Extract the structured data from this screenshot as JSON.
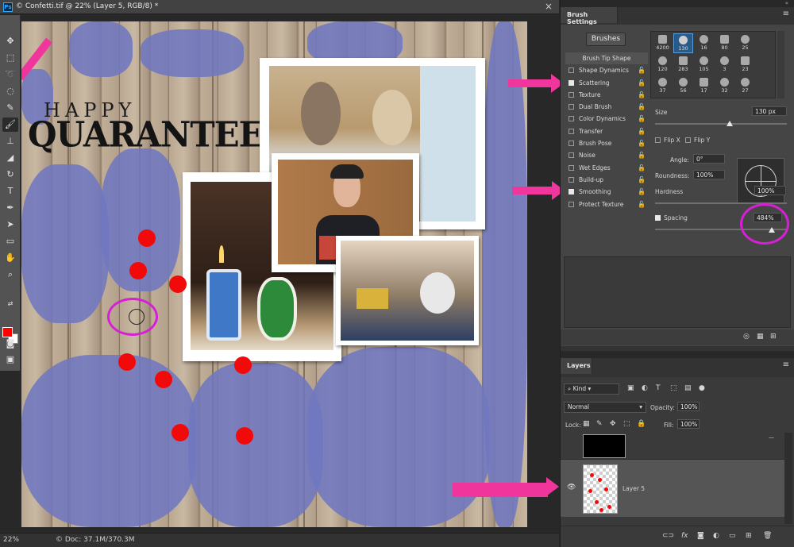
{
  "document": {
    "title": "Confetti.tif @ 22% (Layer 5, RGB/8) *",
    "close_glyph": "×",
    "logo": "Ps"
  },
  "toolbar": {
    "tools": [
      "move-tool",
      "marquee-tool",
      "lasso-tool",
      "quick-select-tool",
      "crop-tool",
      "eyedropper-tool",
      "healing-tool",
      "brush-tool",
      "stamp-tool",
      "history-brush-tool",
      "eraser-tool",
      "gradient-tool",
      "text-tool",
      "pen-tool",
      "path-select-tool",
      "shape-tool",
      "hand-tool",
      "zoom-tool"
    ],
    "active": "brush-tool",
    "fg_color": "#ff0000",
    "bg_color": "#ffffff"
  },
  "canvas": {
    "happy_text": "HAPPY",
    "quaranteen_text": "QUARANTEEN",
    "dot_color": "#f20a0a",
    "annotation_color": "#f0359d",
    "ring_color": "#d61fd6"
  },
  "status": {
    "zoom": "22%",
    "doc_size": "Doc: 37.1M/370.3M"
  },
  "brush_settings": {
    "tab": "Brush Settings",
    "brushes_button": "Brushes",
    "options": [
      {
        "label": "Brush Tip Shape",
        "header": true
      },
      {
        "label": "Shape Dynamics",
        "checked": false
      },
      {
        "label": "Scattering",
        "checked": true
      },
      {
        "label": "Texture",
        "checked": false
      },
      {
        "label": "Dual Brush",
        "checked": false
      },
      {
        "label": "Color Dynamics",
        "checked": false
      },
      {
        "label": "Transfer",
        "checked": false
      },
      {
        "label": "Brush Pose",
        "checked": false
      },
      {
        "label": "Noise",
        "checked": false
      },
      {
        "label": "Wet Edges",
        "checked": false
      },
      {
        "label": "Build-up",
        "checked": false
      },
      {
        "label": "Smoothing",
        "checked": true
      },
      {
        "label": "Protect Texture",
        "checked": false
      }
    ],
    "tips": [
      "4200",
      "130",
      "16",
      "80",
      "25",
      "120",
      "283",
      "105",
      "3",
      "23",
      "37",
      "56",
      "17",
      "32",
      "27"
    ],
    "selected_tip": "130",
    "size_label": "Size",
    "size_value": "130 px",
    "flip_x": "Flip X",
    "flip_y": "Flip Y",
    "angle_label": "Angle:",
    "angle_value": "0°",
    "roundness_label": "Roundness:",
    "roundness_value": "100%",
    "hardness_label": "Hardness",
    "hardness_value": "100%",
    "spacing_label": "Spacing",
    "spacing_value": "484%",
    "spacing_checked": true
  },
  "layers": {
    "tab": "Layers",
    "kind": "Kind",
    "blend_mode": "Normal",
    "opacity_label": "Opacity:",
    "opacity_value": "100%",
    "lock_label": "Lock:",
    "fill_label": "Fill:",
    "fill_value": "100%",
    "items": [
      {
        "name": "",
        "thumb": "black"
      },
      {
        "name": "Layer 5",
        "thumb": "dots",
        "visible": true
      }
    ]
  }
}
